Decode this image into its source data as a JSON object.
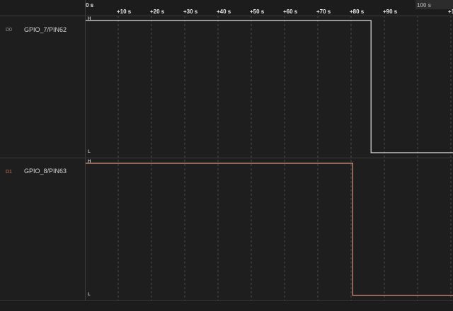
{
  "ruler": {
    "ticks_upper": [
      "0 s",
      "100 s"
    ],
    "ticks_lower": [
      "+10 s",
      "+20 s",
      "+30 s",
      "+40 s",
      "+50 s",
      "+60 s",
      "+70 s",
      "+80 s",
      "+90 s",
      "+1"
    ]
  },
  "channels": [
    {
      "id": "D0",
      "name": "GPIO_7/PIN62",
      "high_label": "H",
      "low_label": "L",
      "color": "#e0e0e0",
      "falls_at_s": 86
    },
    {
      "id": "D1",
      "name": "GPIO_8/PIN63",
      "high_label": "H",
      "low_label": "L",
      "color": "#d8917c",
      "falls_at_s": 80.5
    }
  ],
  "colors": {
    "background": "#1e1e1e",
    "grid": "#4a4a4a",
    "divider": "#3a3a3a"
  }
}
